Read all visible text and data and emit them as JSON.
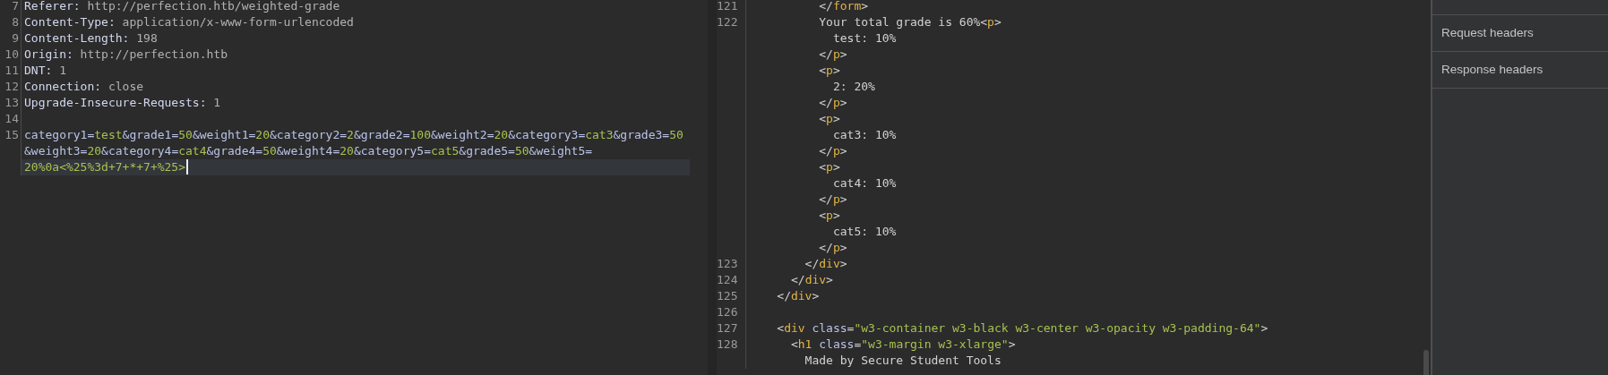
{
  "request_editor": {
    "lines": [
      {
        "number": "7",
        "current": false,
        "rows": [
          {
            "segments": [
              {
                "kind": "header-name",
                "text": "Referer:"
              },
              {
                "kind": "header-value",
                "text": " http://perfection.htb/weighted-grade"
              }
            ]
          }
        ]
      },
      {
        "number": "8",
        "current": false,
        "rows": [
          {
            "segments": [
              {
                "kind": "header-name",
                "text": "Content-Type:"
              },
              {
                "kind": "header-value",
                "text": " application/x-www-form-urlencoded"
              }
            ]
          }
        ]
      },
      {
        "number": "9",
        "current": false,
        "rows": [
          {
            "segments": [
              {
                "kind": "header-name",
                "text": "Content-Length:"
              },
              {
                "kind": "header-value",
                "text": " 198"
              }
            ]
          }
        ]
      },
      {
        "number": "10",
        "current": false,
        "rows": [
          {
            "segments": [
              {
                "kind": "header-name",
                "text": "Origin:"
              },
              {
                "kind": "header-value",
                "text": " http://perfection.htb"
              }
            ]
          }
        ]
      },
      {
        "number": "11",
        "current": false,
        "rows": [
          {
            "segments": [
              {
                "kind": "header-name",
                "text": "DNT:"
              },
              {
                "kind": "header-value",
                "text": " 1"
              }
            ]
          }
        ]
      },
      {
        "number": "12",
        "current": false,
        "rows": [
          {
            "segments": [
              {
                "kind": "header-name",
                "text": "Connection:"
              },
              {
                "kind": "header-value",
                "text": " close"
              }
            ]
          }
        ]
      },
      {
        "number": "13",
        "current": false,
        "rows": [
          {
            "segments": [
              {
                "kind": "header-name",
                "text": "Upgrade-Insecure-Requests:"
              },
              {
                "kind": "header-value",
                "text": " 1"
              }
            ]
          }
        ]
      },
      {
        "number": "14",
        "current": false,
        "rows": [
          {
            "segments": []
          }
        ]
      },
      {
        "number": "15",
        "current": true,
        "rows": [
          {
            "segments": [
              {
                "kind": "param-name",
                "text": "category1="
              },
              {
                "kind": "param-value",
                "text": "test"
              },
              {
                "kind": "param-name",
                "text": "&grade1="
              },
              {
                "kind": "param-value",
                "text": "50"
              },
              {
                "kind": "param-name",
                "text": "&weight1="
              },
              {
                "kind": "param-value",
                "text": "20"
              },
              {
                "kind": "param-name",
                "text": "&category2="
              },
              {
                "kind": "param-value",
                "text": "2"
              },
              {
                "kind": "param-name",
                "text": "&grade2="
              },
              {
                "kind": "param-value",
                "text": "100"
              },
              {
                "kind": "param-name",
                "text": "&weight2="
              },
              {
                "kind": "param-value",
                "text": "20"
              },
              {
                "kind": "param-name",
                "text": "&category3="
              },
              {
                "kind": "param-value",
                "text": "cat3"
              },
              {
                "kind": "param-name",
                "text": "&grade3="
              },
              {
                "kind": "param-value",
                "text": "50"
              }
            ]
          },
          {
            "segments": [
              {
                "kind": "param-name",
                "text": "&weight3="
              },
              {
                "kind": "param-value",
                "text": "20"
              },
              {
                "kind": "param-name",
                "text": "&category4="
              },
              {
                "kind": "param-value",
                "text": "cat4"
              },
              {
                "kind": "param-name",
                "text": "&grade4="
              },
              {
                "kind": "param-value",
                "text": "50"
              },
              {
                "kind": "param-name",
                "text": "&weight4="
              },
              {
                "kind": "param-value",
                "text": "20"
              },
              {
                "kind": "param-name",
                "text": "&category5="
              },
              {
                "kind": "param-value",
                "text": "cat5"
              },
              {
                "kind": "param-name",
                "text": "&grade5="
              },
              {
                "kind": "param-value",
                "text": "50"
              },
              {
                "kind": "param-name",
                "text": "&weight5="
              }
            ]
          },
          {
            "segments": [
              {
                "kind": "param-value",
                "text": "20%0a<%25%3d+7+*+7+%25>"
              }
            ]
          }
        ]
      }
    ]
  },
  "response_editor": {
    "lines": [
      {
        "number": "121",
        "current": false,
        "rows": [
          {
            "segments": [
              {
                "kind": "punct",
                "text": "          </"
              },
              {
                "kind": "tag",
                "text": "form"
              },
              {
                "kind": "punct",
                "text": ">"
              }
            ]
          }
        ]
      },
      {
        "number": "122",
        "current": false,
        "rows": [
          {
            "segments": [
              {
                "kind": "text",
                "text": "          Your total grade is 60%"
              },
              {
                "kind": "punct",
                "text": "<"
              },
              {
                "kind": "tag",
                "text": "p"
              },
              {
                "kind": "punct",
                "text": ">"
              }
            ]
          },
          {
            "segments": [
              {
                "kind": "text",
                "text": "            test: 10%"
              }
            ]
          },
          {
            "segments": [
              {
                "kind": "punct",
                "text": "          </"
              },
              {
                "kind": "tag",
                "text": "p"
              },
              {
                "kind": "punct",
                "text": ">"
              }
            ]
          },
          {
            "segments": [
              {
                "kind": "punct",
                "text": "          <"
              },
              {
                "kind": "tag",
                "text": "p"
              },
              {
                "kind": "punct",
                "text": ">"
              }
            ]
          },
          {
            "segments": [
              {
                "kind": "text",
                "text": "            2: 20%"
              }
            ]
          },
          {
            "segments": [
              {
                "kind": "punct",
                "text": "          </"
              },
              {
                "kind": "tag",
                "text": "p"
              },
              {
                "kind": "punct",
                "text": ">"
              }
            ]
          },
          {
            "segments": [
              {
                "kind": "punct",
                "text": "          <"
              },
              {
                "kind": "tag",
                "text": "p"
              },
              {
                "kind": "punct",
                "text": ">"
              }
            ]
          },
          {
            "segments": [
              {
                "kind": "text",
                "text": "            cat3: 10%"
              }
            ]
          },
          {
            "segments": [
              {
                "kind": "punct",
                "text": "          </"
              },
              {
                "kind": "tag",
                "text": "p"
              },
              {
                "kind": "punct",
                "text": ">"
              }
            ]
          },
          {
            "segments": [
              {
                "kind": "punct",
                "text": "          <"
              },
              {
                "kind": "tag",
                "text": "p"
              },
              {
                "kind": "punct",
                "text": ">"
              }
            ]
          },
          {
            "segments": [
              {
                "kind": "text",
                "text": "            cat4: 10%"
              }
            ]
          },
          {
            "segments": [
              {
                "kind": "punct",
                "text": "          </"
              },
              {
                "kind": "tag",
                "text": "p"
              },
              {
                "kind": "punct",
                "text": ">"
              }
            ]
          },
          {
            "segments": [
              {
                "kind": "punct",
                "text": "          <"
              },
              {
                "kind": "tag",
                "text": "p"
              },
              {
                "kind": "punct",
                "text": ">"
              }
            ]
          },
          {
            "segments": [
              {
                "kind": "text",
                "text": "            cat5: 10%"
              }
            ]
          },
          {
            "segments": [
              {
                "kind": "punct",
                "text": "          </"
              },
              {
                "kind": "tag",
                "text": "p"
              },
              {
                "kind": "punct",
                "text": ">"
              }
            ]
          }
        ]
      },
      {
        "number": "123",
        "current": false,
        "rows": [
          {
            "segments": [
              {
                "kind": "punct",
                "text": "        </"
              },
              {
                "kind": "tag",
                "text": "div"
              },
              {
                "kind": "punct",
                "text": ">"
              }
            ]
          }
        ]
      },
      {
        "number": "124",
        "current": false,
        "rows": [
          {
            "segments": [
              {
                "kind": "punct",
                "text": "      </"
              },
              {
                "kind": "tag",
                "text": "div"
              },
              {
                "kind": "punct",
                "text": ">"
              }
            ]
          }
        ]
      },
      {
        "number": "125",
        "current": false,
        "rows": [
          {
            "segments": [
              {
                "kind": "punct",
                "text": "    </"
              },
              {
                "kind": "tag",
                "text": "div"
              },
              {
                "kind": "punct",
                "text": ">"
              }
            ]
          }
        ]
      },
      {
        "number": "126",
        "current": false,
        "rows": [
          {
            "segments": []
          }
        ]
      },
      {
        "number": "127",
        "current": false,
        "rows": [
          {
            "segments": [
              {
                "kind": "punct",
                "text": "    <"
              },
              {
                "kind": "tag",
                "text": "div"
              },
              {
                "kind": "attr",
                "text": " class"
              },
              {
                "kind": "punct",
                "text": "="
              },
              {
                "kind": "string",
                "text": "\"w3-container w3-black w3-center w3-opacity w3-padding-64\""
              },
              {
                "kind": "punct",
                "text": ">"
              }
            ]
          }
        ]
      },
      {
        "number": "128",
        "current": false,
        "rows": [
          {
            "segments": [
              {
                "kind": "punct",
                "text": "      <"
              },
              {
                "kind": "tag",
                "text": "h1"
              },
              {
                "kind": "attr",
                "text": " class"
              },
              {
                "kind": "punct",
                "text": "="
              },
              {
                "kind": "string",
                "text": "\"w3-margin w3-xlarge\""
              },
              {
                "kind": "punct",
                "text": ">"
              }
            ]
          },
          {
            "segments": [
              {
                "kind": "text",
                "text": "        Made by Secure Student Tools"
              }
            ]
          }
        ]
      }
    ]
  },
  "inspector": {
    "items": [
      {
        "label": "Request headers"
      },
      {
        "label": "Response headers"
      }
    ]
  }
}
